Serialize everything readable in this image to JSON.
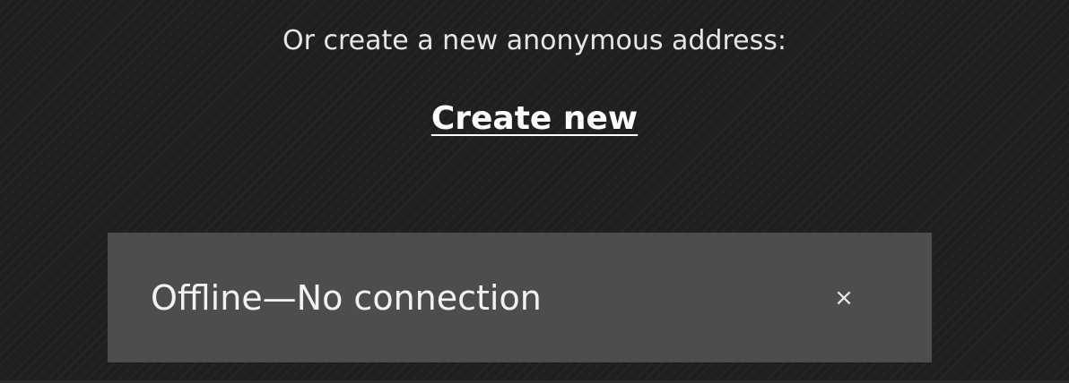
{
  "create_section": {
    "prompt": "Or create a new anonymous address:",
    "create_link_label": "Create new"
  },
  "toast": {
    "message": "Offline—No connection",
    "close_glyph": "×",
    "close_icon": "close-icon"
  },
  "colors": {
    "background": "#1f1f1f",
    "toast_background": "#4d4d4d",
    "text": "#ffffff"
  }
}
